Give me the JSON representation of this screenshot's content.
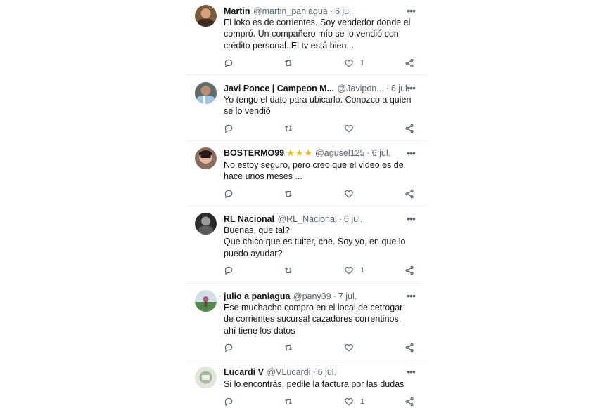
{
  "tweets": [
    {
      "name": "Martin",
      "handle": "@martin_paniagua",
      "date": "6 jul.",
      "text": "El loko es de corrientes. Soy vendedor donde el compró.  Un compañero mío se lo vendió con crédito personal. El tv está bien...",
      "likes": "1",
      "avatar": "avatar-martin"
    },
    {
      "name": "Javi Ponce | Campeon M...",
      "handle": "@Javipon...",
      "date": "6 jul.",
      "text": "Yo tengo el dato para ubicarlo. Conozco a quien se lo vendió",
      "likes": "",
      "avatar": "avatar-javi"
    },
    {
      "name": "BOSTERMO99",
      "stars": "★★★",
      "handle": "@agusel125",
      "date": "6 jul.",
      "text": "No estoy seguro, pero creo que el video es de hace unos meses ...",
      "likes": "",
      "avatar": "avatar-bostermo"
    },
    {
      "name": "RL Nacional",
      "handle": "@RL_Nacional",
      "date": "6 jul.",
      "text": "Buenas,  que tal?\nQue chico que es tuiter, che.  Soy yo, en que lo puedo ayudar?",
      "likes": "1",
      "avatar": "avatar-rl"
    },
    {
      "name": "julio a paniagua",
      "handle": "@pany39",
      "date": "7 jul.",
      "text": "Ese muchacho compro en el local de cetrogar de corrientes sucursal cazadores correntinos, ahí tiene los datos",
      "likes": "",
      "avatar": "avatar-julio"
    },
    {
      "name": "Lucardi V",
      "handle": "@VLucardi",
      "date": "6 jul.",
      "text": "Si lo encontrás, pedile la factura por las dudas",
      "likes": "1",
      "avatar": "avatar-lucardi"
    }
  ],
  "more_glyph": "•••",
  "icons": [
    "reply-icon",
    "retweet-icon",
    "like-icon",
    "share-icon",
    "more-icon"
  ],
  "colors": {
    "text": "#0f1419",
    "muted": "#536471",
    "divider": "#eff3f4",
    "stars": "#f4b400"
  }
}
